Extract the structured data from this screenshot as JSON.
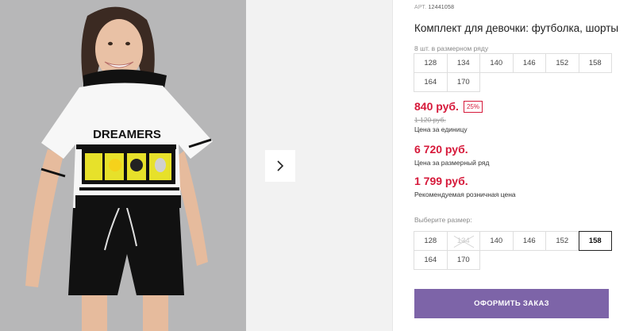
{
  "gallery": {
    "next_icon": "chevron-right-icon",
    "shirt_print": "DREAMERS"
  },
  "product": {
    "sku_label": "АРТ.",
    "sku_value": "12441058",
    "title": "Комплект для девочки: футболка, шорты",
    "pack_note": "8 шт. в размерном ряду",
    "pack_sizes": [
      "128",
      "134",
      "140",
      "146",
      "152",
      "158",
      "164",
      "170"
    ]
  },
  "pricing": {
    "unit_price": "840 руб.",
    "discount": "25%",
    "old_price": "1 120 руб.",
    "unit_caption": "Цена за единицу",
    "pack_price": "6 720 руб.",
    "pack_caption": "Цена за размерный ряд",
    "retail_price": "1 799 руб.",
    "retail_caption": "Рекомендуемая розничная цена",
    "accent_color": "#d6193a"
  },
  "size_selector": {
    "label": "Выберите размер:",
    "sizes": [
      {
        "value": "128",
        "state": "available"
      },
      {
        "value": "134",
        "state": "unavailable"
      },
      {
        "value": "140",
        "state": "available"
      },
      {
        "value": "146",
        "state": "available"
      },
      {
        "value": "152",
        "state": "available"
      },
      {
        "value": "158",
        "state": "selected"
      },
      {
        "value": "164",
        "state": "available"
      },
      {
        "value": "170",
        "state": "available"
      }
    ]
  },
  "order_button": {
    "label": "ОФОРМИТЬ ЗАКАЗ",
    "color": "#7d64a8"
  }
}
